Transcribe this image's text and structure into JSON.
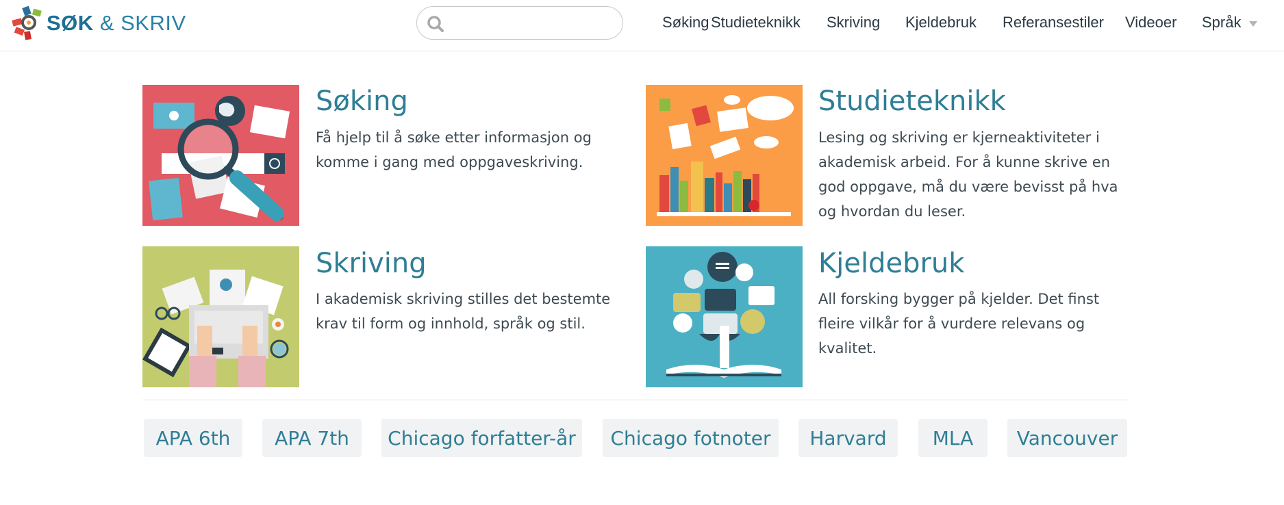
{
  "logo": {
    "text_bold": "SØK",
    "text_rest": "& SKRIV"
  },
  "search": {
    "value": "",
    "placeholder": ""
  },
  "nav": {
    "items": [
      "Søking",
      "Studieteknikk",
      "Skriving",
      "Kjeldebruk",
      "Referansestiler",
      "Videoer",
      "Språk"
    ]
  },
  "cards": [
    {
      "title": "Søking",
      "description": "Få hjelp til å søke etter informasjon og komme i gang med oppgaveskriving."
    },
    {
      "title": "Studieteknikk",
      "description": "Lesing og skriving er kjerneaktiviteter i akademisk arbeid. For å kunne skrive en god oppgave, må du være bevisst på hva og hvordan du leser."
    },
    {
      "title": "Skriving",
      "description": "I akademisk skriving stilles det bestemte krav til form og innhold, språk og stil."
    },
    {
      "title": "Kjeldebruk",
      "description": "All forsking bygger på kjelder. Det finst fleire vilkår for å vurdere relevans og kvalitet."
    }
  ],
  "reference_styles": [
    "APA 6th",
    "APA 7th",
    "Chicago forfatter-år",
    "Chicago fotnoter",
    "Harvard",
    "MLA",
    "Vancouver"
  ],
  "colors": {
    "brand": "#2a82a6",
    "card_title": "#2f7e95",
    "tile_soking": "#e15a64",
    "tile_studieteknikk": "#fb9d47",
    "tile_skriving": "#c2cb6e",
    "tile_kjeldebruk": "#4bb0c4"
  }
}
